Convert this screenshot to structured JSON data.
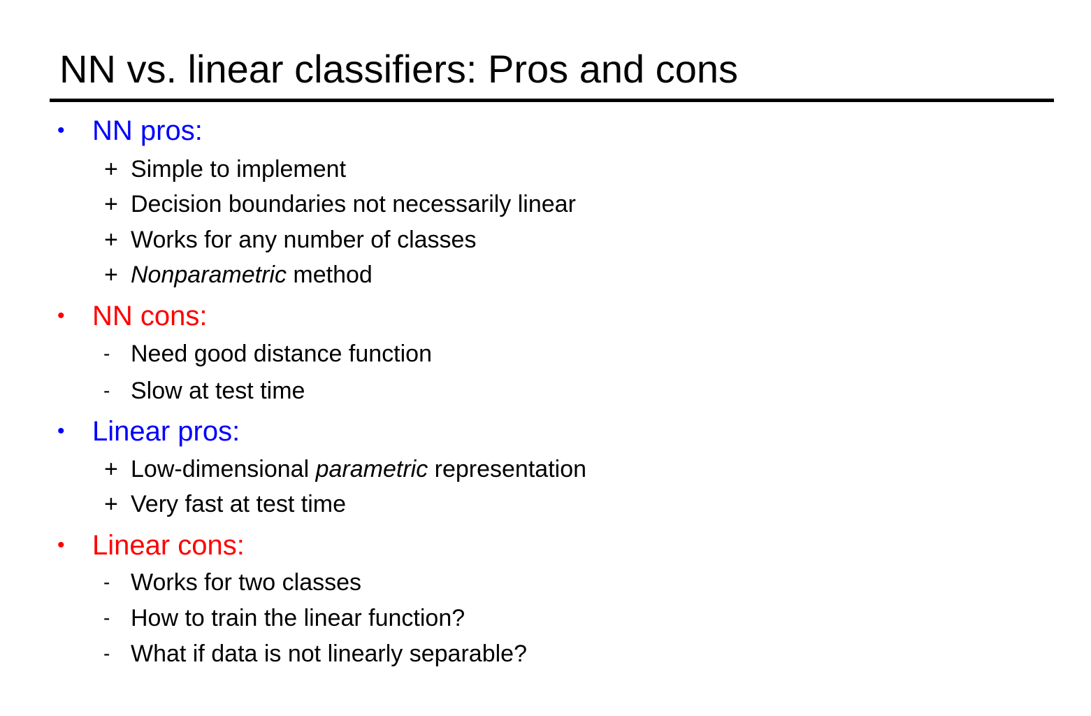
{
  "title": "NN vs. linear classifiers: Pros and cons",
  "colors": {
    "pros": "#0000ff",
    "cons": "#ff0000",
    "text": "#000000"
  },
  "sections": [
    {
      "bullet": "•",
      "heading": "NN pros:",
      "tone": "pros",
      "items": [
        {
          "marker": "+",
          "before": "Simple to implement",
          "emphasis": "",
          "after": ""
        },
        {
          "marker": "+",
          "before": "Decision boundaries not necessarily linear",
          "emphasis": "",
          "after": ""
        },
        {
          "marker": "+",
          "before": "Works for any number of classes",
          "emphasis": "",
          "after": ""
        },
        {
          "marker": "+",
          "before": "",
          "emphasis": "Nonparametric",
          "after": " method"
        }
      ]
    },
    {
      "bullet": "•",
      "heading": "NN cons:",
      "tone": "cons",
      "items": [
        {
          "marker": "-",
          "before": "Need good distance function",
          "emphasis": "",
          "after": ""
        },
        {
          "marker": "-",
          "before": "Slow at test time",
          "emphasis": "",
          "after": ""
        }
      ]
    },
    {
      "bullet": "•",
      "heading": "Linear pros:",
      "tone": "pros",
      "items": [
        {
          "marker": "+",
          "before": "Low-dimensional ",
          "emphasis": "parametric",
          "after": " representation"
        },
        {
          "marker": "+",
          "before": "Very fast at test time",
          "emphasis": "",
          "after": ""
        }
      ]
    },
    {
      "bullet": "•",
      "heading": "Linear cons:",
      "tone": "cons",
      "items": [
        {
          "marker": "-",
          "before": "Works for two classes",
          "emphasis": "",
          "after": ""
        },
        {
          "marker": "-",
          "before": "How to train the linear function?",
          "emphasis": "",
          "after": ""
        },
        {
          "marker": "-",
          "before": "What if data is not linearly separable?",
          "emphasis": "",
          "after": ""
        }
      ]
    }
  ]
}
